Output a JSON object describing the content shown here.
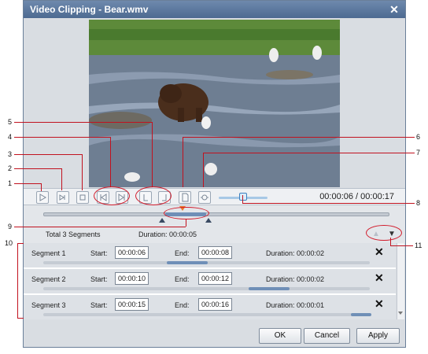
{
  "window": {
    "title": "Video Clipping - Bear.wmv"
  },
  "player": {
    "timecode": "00:00:06 / 00:00:17",
    "volume": 0.5
  },
  "segments_header": {
    "total": "Total 3 Segments",
    "duration": "Duration: 00:00:05"
  },
  "segments": [
    {
      "name": "Segment 1",
      "start_label": "Start:",
      "start": "00:00:06",
      "end_label": "End:",
      "end": "00:00:08",
      "duration": "Duration: 00:00:02"
    },
    {
      "name": "Segment 2",
      "start_label": "Start:",
      "start": "00:00:10",
      "end_label": "End:",
      "end": "00:00:12",
      "duration": "Duration: 00:00:02"
    },
    {
      "name": "Segment 3",
      "start_label": "Start:",
      "start": "00:00:15",
      "end_label": "End:",
      "end": "00:00:16",
      "duration": "Duration: 00:00:01"
    }
  ],
  "buttons": {
    "ok": "OK",
    "cancel": "Cancel",
    "apply": "Apply"
  },
  "callouts": [
    "1",
    "2",
    "3",
    "4",
    "5",
    "6",
    "7",
    "8",
    "9",
    "10",
    "11"
  ],
  "colors": {
    "accent": "#3c7fbf",
    "annotation": "#c1121f",
    "segment": "#6f8fb7",
    "marker": "#e8782a"
  },
  "icons": [
    "play-icon",
    "next-frame-icon",
    "stop-icon",
    "prev-segment-icon",
    "next-segment-icon",
    "mark-start-icon",
    "mark-end-icon",
    "new-segment-icon",
    "snapshot-icon",
    "volume-icon",
    "move-up-icon",
    "move-down-icon",
    "close-icon",
    "delete-icon"
  ]
}
